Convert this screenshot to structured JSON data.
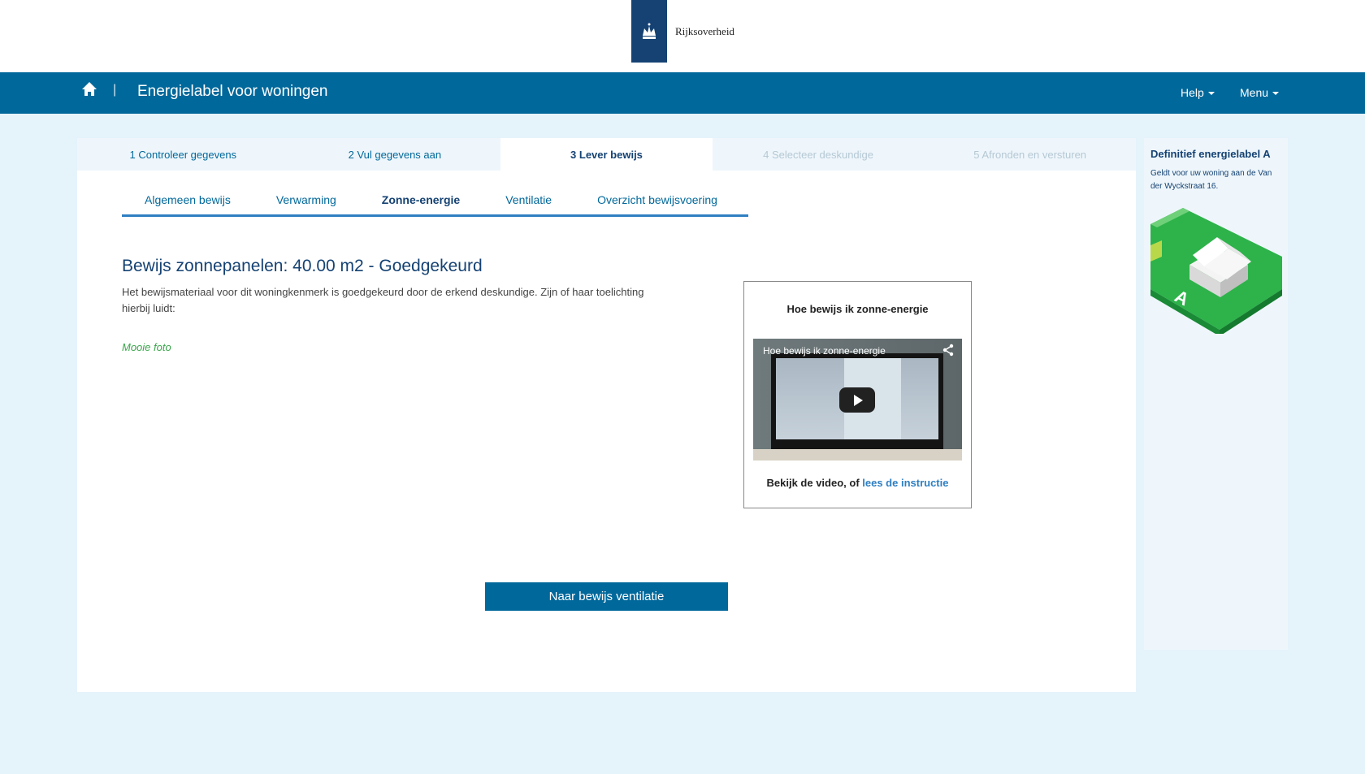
{
  "header": {
    "logo_text": "Rijksoverheid",
    "app_title": "Energielabel voor woningen",
    "separator": "|",
    "help_label": "Help",
    "menu_label": "Menu"
  },
  "steps": [
    {
      "label": "1 Controleer gegevens",
      "state": "done"
    },
    {
      "label": "2 Vul gegevens aan",
      "state": "done"
    },
    {
      "label": "3 Lever bewijs",
      "state": "active"
    },
    {
      "label": "4 Selecteer deskundige",
      "state": "disabled"
    },
    {
      "label": "5 Afronden en versturen",
      "state": "disabled"
    }
  ],
  "subtabs": [
    {
      "label": "Algemeen bewijs",
      "active": false
    },
    {
      "label": "Verwarming",
      "active": false
    },
    {
      "label": "Zonne-energie",
      "active": true
    },
    {
      "label": "Ventilatie",
      "active": false
    },
    {
      "label": "Overzicht bewijsvoering",
      "active": false
    }
  ],
  "proof": {
    "title": "Bewijs zonnepanelen: 40.00 m2 - Goedgekeurd",
    "text": "Het bewijsmateriaal voor dit woningkenmerk is goedgekeurd door de erkend deskundige. Zijn of haar toelichting hierbij luidt:",
    "comment": "Mooie foto"
  },
  "video": {
    "heading": "Hoe bewijs ik zonne-energie",
    "player_title": "Hoe bewijs ik zonne-energie",
    "caption_prefix": "Bekijk de video, of ",
    "caption_link": "lees de instructie"
  },
  "next_button": "Naar bewijs ventilatie",
  "sidebar": {
    "title": "Definitief energielabel A",
    "description": "Geldt voor uw woning aan de Van der Wyckstraat 16.",
    "label_letter": "A"
  },
  "colors": {
    "brand_dark": "#154273",
    "brand": "#01689b",
    "page_bg": "#e5f3fb",
    "success": "#39a64a",
    "label_green": "#2db34a"
  }
}
